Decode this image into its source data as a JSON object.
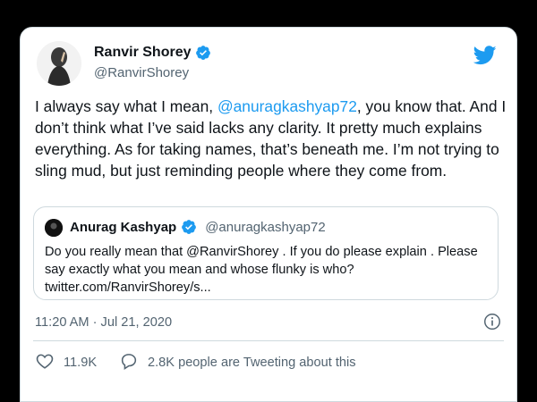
{
  "author": {
    "display_name": "Ranvir Shorey",
    "handle": "@RanvirShorey"
  },
  "tweet": {
    "text_parts": {
      "before_mention": "I always say what I mean, ",
      "mention": "@anuragkashyap72",
      "after_mention": ", you know that. And I don’t think what I’ve said lacks any clarity. It pretty much explains everything. As for taking names, that’s beneath me. I’m not trying to sling mud, but just reminding people where they come from."
    },
    "timestamp": "11:20 AM · Jul 21, 2020"
  },
  "quoted_tweet": {
    "display_name": "Anurag Kashyap",
    "handle": "@anuragkashyap72",
    "text": "Do you really mean that @RanvirShorey . If you do please explain . Please say exactly what you mean and whose flunky is who? twitter.com/RanvirShorey/s..."
  },
  "stats": {
    "likes": "11.9K",
    "conversation": "2.8K people are Tweeting about this"
  },
  "colors": {
    "accent": "#1d9bf0",
    "muted": "#536471",
    "border": "#cfd9de"
  },
  "icons": {
    "brand": "twitter-bird-icon",
    "verified": "verified-badge-icon",
    "info": "info-icon",
    "like": "heart-icon",
    "reply": "speech-bubble-icon"
  }
}
